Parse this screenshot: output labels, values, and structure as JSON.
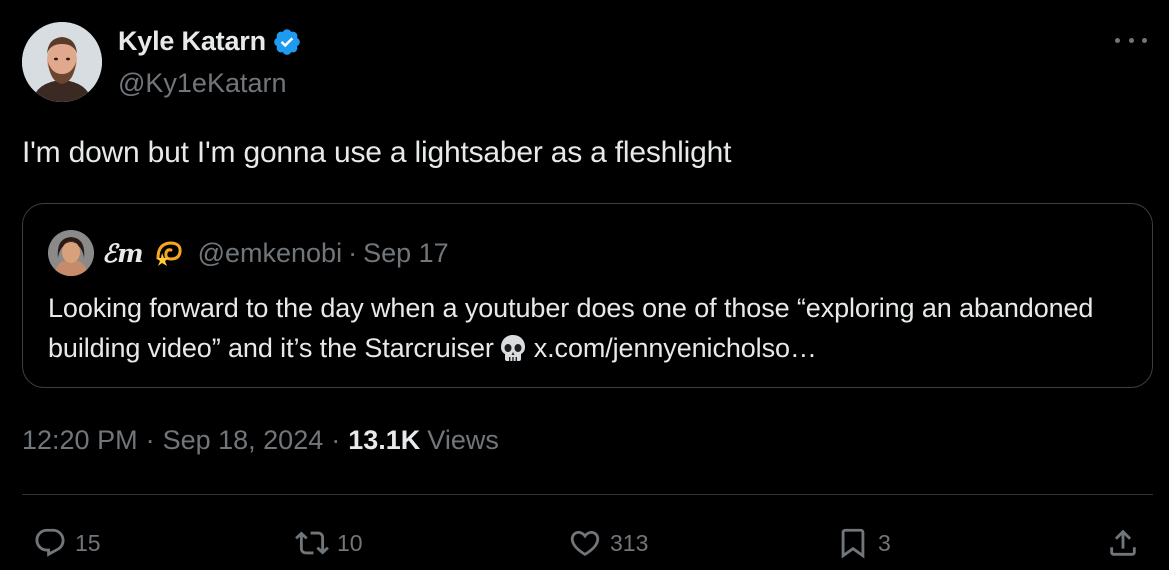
{
  "author": {
    "name": "Kyle Katarn",
    "handle": "@Ky1eKatarn",
    "verified": true
  },
  "tweet": {
    "text": "I'm down but I'm gonna use a lightsaber as a fleshlight"
  },
  "quote": {
    "name": "ℰm",
    "emoji": "dizzy-star-emoji",
    "handle": "@emkenobi",
    "separator": "·",
    "date": "Sep 17",
    "text_before": "Looking forward to the day when a youtuber does one of those “exploring an abandoned building video” and it’s the Starcruiser",
    "text_emoji": "skull-emoji",
    "text_link": "x.com/jennyenicholso…"
  },
  "meta": {
    "time": "12:20 PM",
    "separator": "·",
    "date": "Sep 18, 2024",
    "views_count": "13.1K",
    "views_label": "Views"
  },
  "actions": {
    "reply_count": "15",
    "retweet_count": "10",
    "like_count": "313",
    "bookmark_count": "3"
  },
  "colors": {
    "background": "#000000",
    "text_primary": "#e7e9ea",
    "text_secondary": "#71767b",
    "verified_blue": "#1d9bf0",
    "border": "#2f3336"
  }
}
